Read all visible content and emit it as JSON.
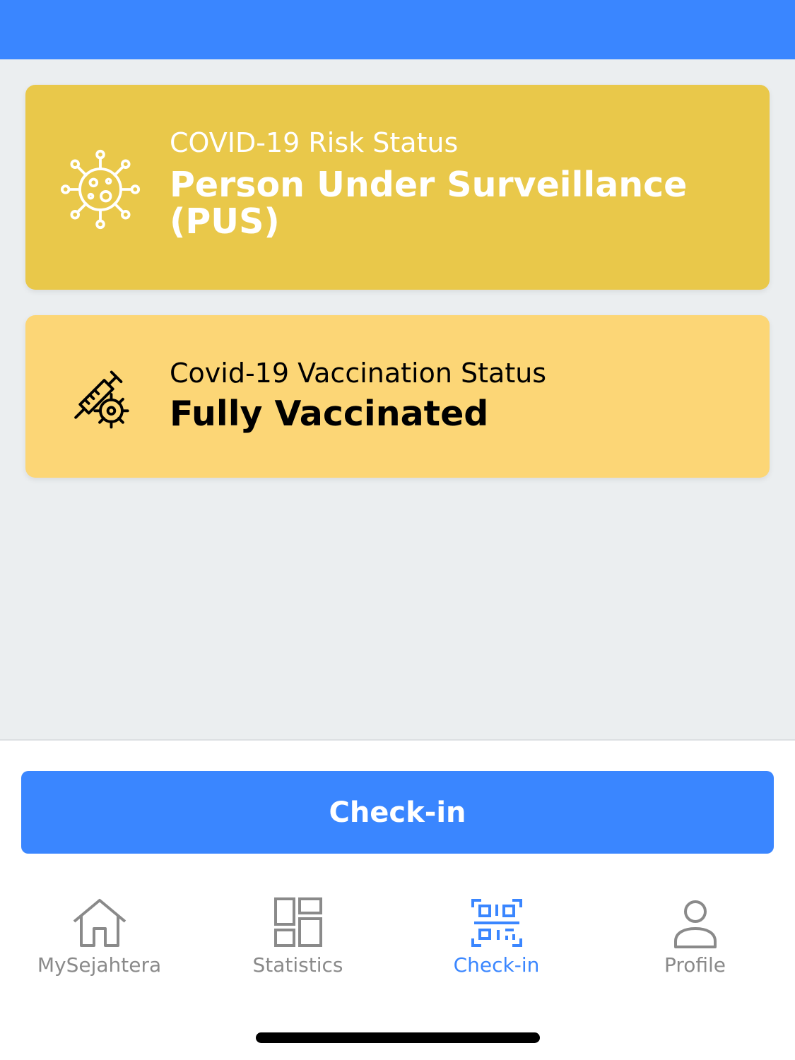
{
  "colors": {
    "header": "#3a86ff",
    "risk_card": "#e9c84a",
    "vaccination_card": "#fcd676",
    "accent": "#3a86ff",
    "tab_inactive": "#8a8a8a"
  },
  "risk_card": {
    "icon": "virus-icon",
    "label": "COVID-19 Risk Status",
    "value": "Person Under Surveillance (PUS)"
  },
  "vaccination_card": {
    "icon": "vaccine-syringe-icon",
    "label": "Covid-19 Vaccination Status",
    "value": "Fully Vaccinated"
  },
  "checkin_button": {
    "label": "Check-in"
  },
  "tabbar": {
    "active": "Check-in",
    "tabs": [
      {
        "label": "MySejahtera",
        "icon": "house-icon"
      },
      {
        "label": "Statistics",
        "icon": "dashboard-grid-icon"
      },
      {
        "label": "Check-in",
        "icon": "qr-code-scan-icon"
      },
      {
        "label": "Profile",
        "icon": "person-icon"
      }
    ]
  }
}
